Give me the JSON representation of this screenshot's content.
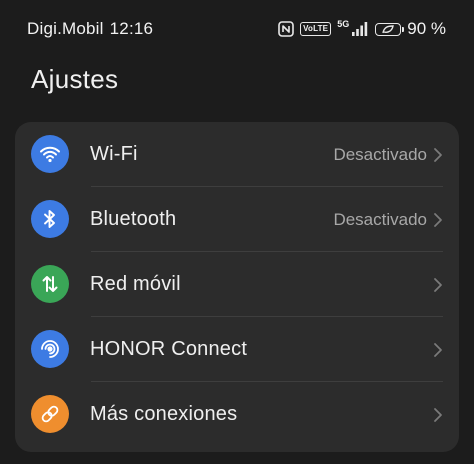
{
  "status_bar": {
    "carrier": "Digi.Mobil",
    "time": "12:16",
    "volte": "VoLTE",
    "network": "5G",
    "battery": "90 %",
    "battery_level": 0.9
  },
  "header": {
    "title": "Ajustes"
  },
  "colors": {
    "wifi": "#3d7be3",
    "bluetooth": "#3d7be3",
    "mobile": "#3aa657",
    "honor": "#3d7be3",
    "more": "#ef8e2e"
  },
  "items": [
    {
      "label": "Wi‑Fi",
      "value": "Desactivado",
      "icon": "wifi-icon"
    },
    {
      "label": "Bluetooth",
      "value": "Desactivado",
      "icon": "bluetooth-icon"
    },
    {
      "label": "Red móvil",
      "value": "",
      "icon": "mobile-data-icon"
    },
    {
      "label": "HONOR Connect",
      "value": "",
      "icon": "honor-connect-icon"
    },
    {
      "label": "Más conexiones",
      "value": "",
      "icon": "link-icon"
    }
  ]
}
